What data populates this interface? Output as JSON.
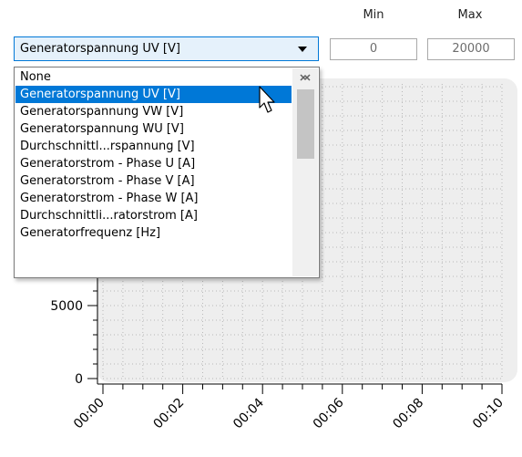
{
  "range": {
    "min_label": "Min",
    "max_label": "Max",
    "min_value": "0",
    "max_value": "20000"
  },
  "signal_select": {
    "selected": "Generatorspannung UV [V]",
    "options": [
      "None",
      "Generatorspannung UV [V]",
      "Generatorspannung VW [V]",
      "Generatorspannung WU [V]",
      "Durchschnittl...rspannung [V]",
      "Generatorstrom - Phase U [A]",
      "Generatorstrom - Phase V [A]",
      "Generatorstrom - Phase W [A]",
      "Durchschnittli...ratorstrom [A]",
      "Generatorfrequenz [Hz]"
    ],
    "highlighted_index": 1
  },
  "chart_data": {
    "type": "line",
    "series": [],
    "y_ticks": [
      0,
      5000
    ],
    "y_tick_labels": [
      "0",
      "5000"
    ],
    "x_tick_labels": [
      "00:00",
      "00:02",
      "00:04",
      "00:06",
      "00:08",
      "00:10"
    ],
    "grid": true
  },
  "colors": {
    "accent": "#0078d7",
    "plot_bg": "#eeeeee"
  },
  "icons": {
    "dropdown": "chevron-down-icon",
    "scroll_up": "chevron-up-icon",
    "scroll_down": "chevron-down-icon",
    "cursor": "mouse-pointer-icon"
  }
}
